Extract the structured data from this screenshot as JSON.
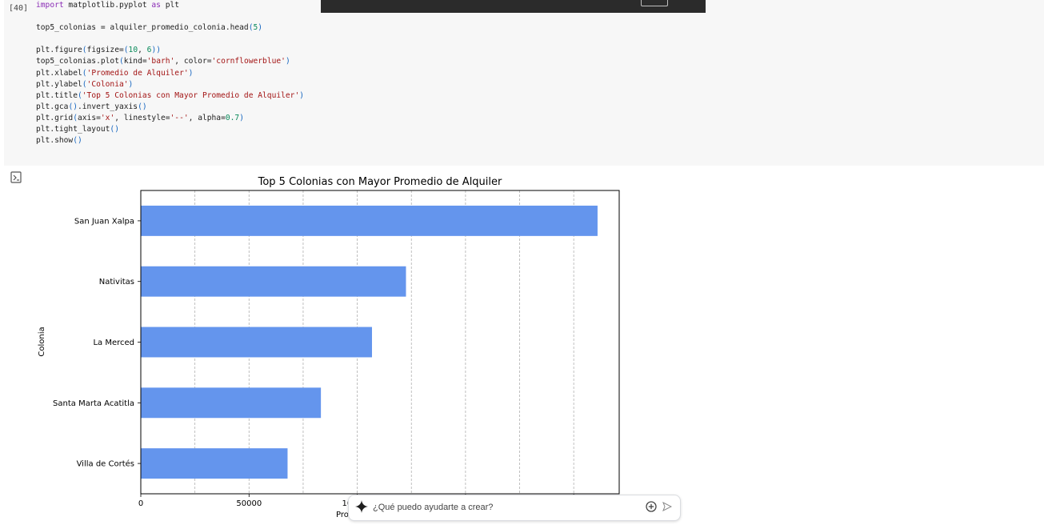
{
  "cell": {
    "execution_count": "[40]",
    "code_lines": [
      [
        [
          "kw",
          "import"
        ],
        [
          "fn",
          " matplotlib.pyplot "
        ],
        [
          "kw",
          "as"
        ],
        [
          "fn",
          " plt"
        ]
      ],
      [],
      [
        [
          "fn",
          "top5_colonias = alquiler_promedio_colonia.head"
        ],
        [
          "paren",
          "("
        ],
        [
          "num",
          "5"
        ],
        [
          "paren",
          ")"
        ]
      ],
      [],
      [
        [
          "fn",
          "plt.figure"
        ],
        [
          "paren",
          "("
        ],
        [
          "fn",
          "figsize="
        ],
        [
          "paren",
          "("
        ],
        [
          "num",
          "10"
        ],
        [
          "fn",
          ", "
        ],
        [
          "num",
          "6"
        ],
        [
          "paren",
          "))"
        ]
      ],
      [
        [
          "fn",
          "top5_colonias.plot"
        ],
        [
          "paren",
          "("
        ],
        [
          "fn",
          "kind="
        ],
        [
          "str",
          "'barh'"
        ],
        [
          "fn",
          ", color="
        ],
        [
          "str",
          "'cornflowerblue'"
        ],
        [
          "paren",
          ")"
        ]
      ],
      [
        [
          "fn",
          "plt.xlabel"
        ],
        [
          "paren",
          "("
        ],
        [
          "str",
          "'Promedio de Alquiler'"
        ],
        [
          "paren",
          ")"
        ]
      ],
      [
        [
          "fn",
          "plt.ylabel"
        ],
        [
          "paren",
          "("
        ],
        [
          "str",
          "'Colonia'"
        ],
        [
          "paren",
          ")"
        ]
      ],
      [
        [
          "fn",
          "plt.title"
        ],
        [
          "paren",
          "("
        ],
        [
          "str",
          "'Top 5 Colonias con Mayor Promedio de Alquiler'"
        ],
        [
          "paren",
          ")"
        ]
      ],
      [
        [
          "fn",
          "plt.gca"
        ],
        [
          "paren",
          "()"
        ],
        [
          "fn",
          ".invert_yaxis"
        ],
        [
          "paren",
          "()"
        ]
      ],
      [
        [
          "fn",
          "plt.grid"
        ],
        [
          "paren",
          "("
        ],
        [
          "fn",
          "axis="
        ],
        [
          "str",
          "'x'"
        ],
        [
          "fn",
          ", linestyle="
        ],
        [
          "str",
          "'--'"
        ],
        [
          "fn",
          ", alpha="
        ],
        [
          "num",
          "0.7"
        ],
        [
          "paren",
          ")"
        ]
      ],
      [
        [
          "fn",
          "plt.tight_layout"
        ],
        [
          "paren",
          "()"
        ]
      ],
      [
        [
          "fn",
          "plt.show"
        ],
        [
          "paren",
          "()"
        ]
      ]
    ]
  },
  "output": {
    "icon": "output-toggle-icon"
  },
  "chart_data": {
    "type": "bar",
    "orientation": "horizontal",
    "title": "Top 5 Colonias con Mayor Promedio de Alquiler",
    "xlabel_visible_fragment": "Pro",
    "ylabel": "Colonia",
    "categories": [
      "San Juan Xalpa",
      "Nativitas",
      "La Merced",
      "Santa Marta Acatitla",
      "Villa de Cortés"
    ],
    "values": [
      211000,
      122500,
      106800,
      83200,
      67800
    ],
    "xlim": [
      0,
      221000
    ],
    "xticks": [
      0,
      50000,
      100000,
      150000,
      200000,
      250000,
      300000,
      350000,
      400000
    ],
    "xtick_labels": [
      "0",
      "50000",
      "100000",
      "150000",
      "20"
    ],
    "bar_color": "#6495ED",
    "grid": "x dashed"
  },
  "gemini_bar": {
    "placeholder": "¿Qué puedo ayudarte a crear?",
    "spark_icon": "gemini-spark-icon",
    "add_icon": "add-circle-icon",
    "send_icon": "send-icon"
  }
}
